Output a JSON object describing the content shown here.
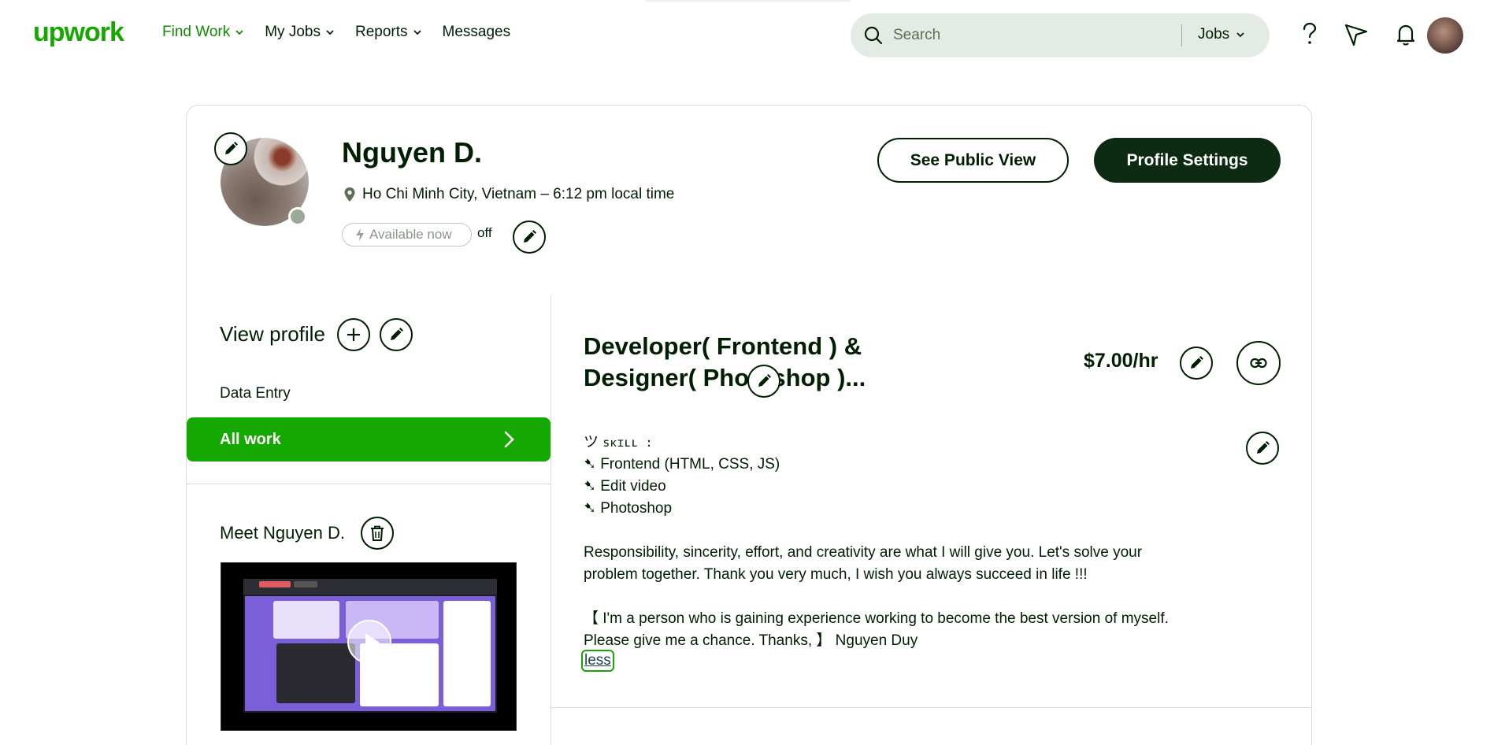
{
  "header": {
    "logo": "upwork",
    "nav": [
      "Find Work",
      "My Jobs",
      "Reports",
      "Messages"
    ],
    "search_placeholder": "Search",
    "search_scope": "Jobs"
  },
  "profile": {
    "name": "Nguyen D.",
    "location": "Ho Chi Minh City, Vietnam – 6:12 pm local time",
    "availability": "Available now",
    "availability_state": "off",
    "see_public_view": "See Public View",
    "profile_settings": "Profile Settings"
  },
  "sidebar": {
    "view_profile": "View profile",
    "category": "Data Entry",
    "all_work": "All work",
    "meet_title": "Meet Nguyen D."
  },
  "main": {
    "title": "Developer( Frontend ) & Designer( Photoshop )...",
    "rate": "$7.00/hr",
    "skill_header_icon": "ツ",
    "skill_header": "sᴋɪʟʟ :",
    "skills": [
      "➷ Frontend (HTML, CSS, JS)",
      "➷ Edit video",
      "➷ Photoshop"
    ],
    "paragraph1_line1": "Responsibility, sincerity, effort, and creativity are what I will give you. Let's solve your",
    "paragraph1_line2": "problem together. Thank you very much, I wish you always succeed in life !!!",
    "paragraph2_line1": "【 I'm a person who is gaining experience working to become the best version of myself.",
    "paragraph2_line2": "Please give me a chance. Thanks, 】 Nguyen Duy",
    "less": "less"
  },
  "colors": {
    "brand_green": "#14a800",
    "dark_green": "#0d2b12",
    "text": "#001e00"
  }
}
